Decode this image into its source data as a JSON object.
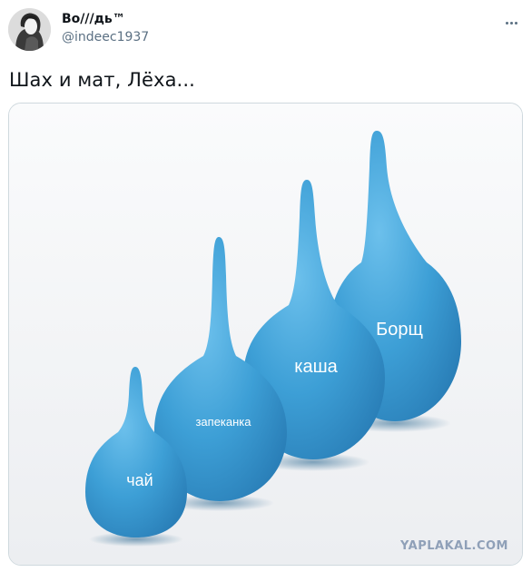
{
  "tweet": {
    "author_name": "Bo///дь™",
    "author_handle": "@indeec1937",
    "text": "Шах и мат, Лёха...",
    "more_icon": "more-dots-icon"
  },
  "media": {
    "bulbs": [
      {
        "label": "чай"
      },
      {
        "label": "запеканка"
      },
      {
        "label": "каша"
      },
      {
        "label": "Борщ"
      }
    ],
    "watermark": "YAPLAKAL.COM",
    "colors": {
      "bulb": "#3d9fd6",
      "bulb_dark": "#2a7fb8",
      "background": "#f4f5f7"
    }
  }
}
